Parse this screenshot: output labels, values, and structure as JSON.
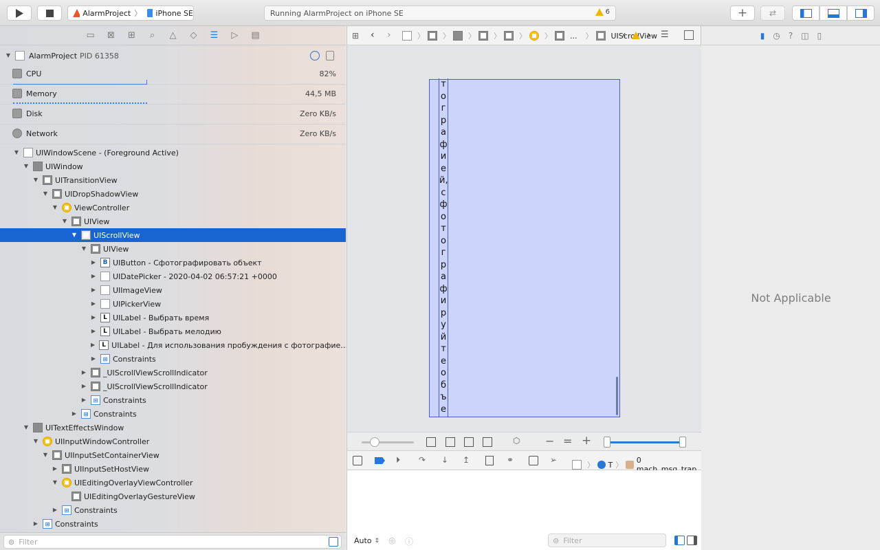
{
  "toolbar": {
    "project": "AlarmProject",
    "device": "iPhone SE",
    "status": "Running AlarmProject on iPhone SE",
    "warnings": "6"
  },
  "navigator": {
    "process": "AlarmProject",
    "pid": "PID 61358",
    "gauges": [
      {
        "name": "CPU",
        "value": "82%"
      },
      {
        "name": "Memory",
        "value": "44,5 MB"
      },
      {
        "name": "Disk",
        "value": "Zero KB/s"
      },
      {
        "name": "Network",
        "value": "Zero KB/s"
      }
    ],
    "tree": [
      "UIWindowScene - (Foreground Active)",
      "UIWindow",
      "UITransitionView",
      "UIDropShadowView",
      "ViewController",
      "UIView",
      "UIScrollView",
      "UIView",
      "UIButton - Сфотографировать объект",
      "UIDatePicker - 2020-04-02 06:57:21 +0000",
      "UIImageView",
      "UIPickerView",
      "UILabel - Выбрать время",
      "UILabel - Выбрать мелодию",
      "UILabel - Для использования пробуждения с фотографие…",
      "Constraints",
      "_UIScrollViewScrollIndicator",
      "_UIScrollViewScrollIndicator",
      "Constraints",
      "Constraints",
      "UITextEffectsWindow",
      "UIInputWindowController",
      "UIInputSetContainerView",
      "UIInputSetHostView",
      "UIEditingOverlayViewController",
      "UIEditingOverlayGestureView",
      "Constraints",
      "Constraints"
    ],
    "filter_placeholder": "Filter"
  },
  "center": {
    "jump_ellipsis": "...",
    "jump_current": "UIScrollView",
    "vertical_text": [
      "т",
      "о",
      "г",
      "р",
      "а",
      "ф",
      "и",
      "е",
      "й,",
      "с",
      "ф",
      "о",
      "т",
      "о",
      "г",
      "р",
      "а",
      "ф",
      "и",
      "р",
      "у",
      "й",
      "т",
      "е",
      "о",
      "б",
      "ъ",
      "е"
    ],
    "thread_frame": "0 mach_msg_trap",
    "thread_letter": "T",
    "console_mode": "Auto",
    "console_filter": "Filter"
  },
  "inspector": {
    "message": "Not Applicable"
  }
}
